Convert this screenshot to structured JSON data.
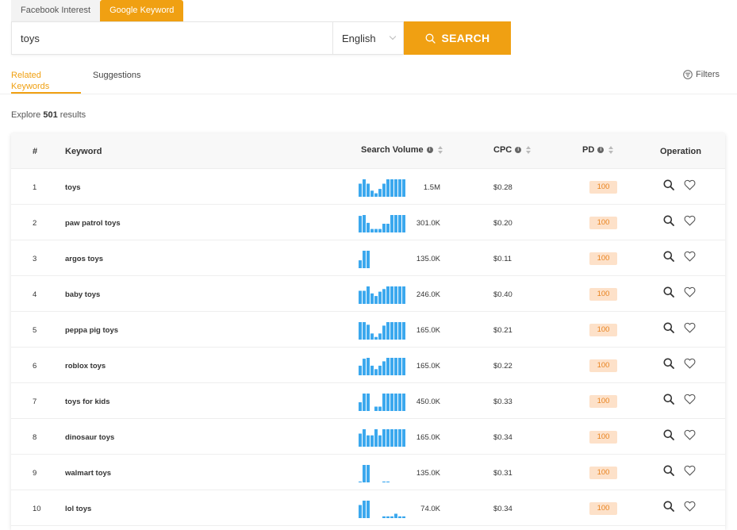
{
  "top_tabs": [
    {
      "label": "Facebook Interest",
      "active": false
    },
    {
      "label": "Google Keyword",
      "active": true
    }
  ],
  "search": {
    "value": "toys",
    "language": "English",
    "button_label": "SEARCH"
  },
  "sub_tabs": [
    {
      "label": "Related Keywords",
      "active": true
    },
    {
      "label": "Suggestions",
      "active": false
    }
  ],
  "filters_label": "Filters",
  "explore": {
    "prefix": "Explore",
    "count": "501",
    "suffix": "results"
  },
  "table": {
    "headers": {
      "num": "#",
      "keyword": "Keyword",
      "volume": "Search Volume",
      "cpc": "CPC",
      "pd": "PD",
      "operation": "Operation"
    },
    "rows": [
      {
        "num": "1",
        "keyword": "toys",
        "volume": "1.5M",
        "cpc": "$0.28",
        "pd": "100",
        "trend": [
          0.75,
          1,
          0.75,
          0.35,
          0.2,
          0.45,
          0.75,
          1,
          1,
          1,
          1,
          1
        ]
      },
      {
        "num": "2",
        "keyword": "paw patrol toys",
        "volume": "301.0K",
        "cpc": "$0.20",
        "pd": "100",
        "trend": [
          0.95,
          1,
          0.55,
          0.2,
          0.2,
          0.2,
          0.5,
          0.5,
          1,
          1,
          1,
          1
        ]
      },
      {
        "num": "3",
        "keyword": "argos toys",
        "volume": "135.0K",
        "cpc": "$0.11",
        "pd": "100",
        "trend": [
          0.45,
          1,
          1,
          0,
          0,
          0,
          0,
          0,
          0,
          0,
          0,
          0
        ]
      },
      {
        "num": "4",
        "keyword": "baby toys",
        "volume": "246.0K",
        "cpc": "$0.40",
        "pd": "100",
        "trend": [
          0.75,
          0.75,
          1,
          0.6,
          0.45,
          0.7,
          0.85,
          1,
          1,
          1,
          1,
          1
        ]
      },
      {
        "num": "5",
        "keyword": "peppa pig toys",
        "volume": "165.0K",
        "cpc": "$0.21",
        "pd": "100",
        "trend": [
          1,
          1,
          0.85,
          0.35,
          0.15,
          0.35,
          0.8,
          1,
          1,
          1,
          1,
          1
        ]
      },
      {
        "num": "6",
        "keyword": "roblox toys",
        "volume": "165.0K",
        "cpc": "$0.22",
        "pd": "100",
        "trend": [
          0.55,
          0.95,
          1,
          0.55,
          0.35,
          0.55,
          0.8,
          1,
          1,
          1,
          1,
          1
        ]
      },
      {
        "num": "7",
        "keyword": "toys for kids",
        "volume": "450.0K",
        "cpc": "$0.33",
        "pd": "100",
        "trend": [
          0.5,
          1,
          1,
          0,
          0.25,
          0.25,
          1,
          1,
          1,
          1,
          1,
          1
        ]
      },
      {
        "num": "8",
        "keyword": "dinosaur toys",
        "volume": "165.0K",
        "cpc": "$0.34",
        "pd": "100",
        "trend": [
          0.75,
          1,
          0.65,
          0.65,
          1,
          0.65,
          1,
          1,
          1,
          1,
          1,
          1
        ]
      },
      {
        "num": "9",
        "keyword": "walmart toys",
        "volume": "135.0K",
        "cpc": "$0.31",
        "pd": "100",
        "trend": [
          0.05,
          1,
          1,
          0,
          0,
          0,
          0.05,
          0.05,
          0,
          0,
          0,
          0
        ]
      },
      {
        "num": "10",
        "keyword": "lol toys",
        "volume": "74.0K",
        "cpc": "$0.34",
        "pd": "100",
        "trend": [
          0.75,
          1,
          1,
          0,
          0,
          0,
          0.1,
          0.1,
          0.1,
          0.25,
          0.1,
          0.1
        ]
      }
    ]
  },
  "colors": {
    "accent": "#f0a012",
    "spark": "#3ba8ee",
    "pd_bg": "#fde1c9",
    "pd_text": "#e8831f"
  }
}
